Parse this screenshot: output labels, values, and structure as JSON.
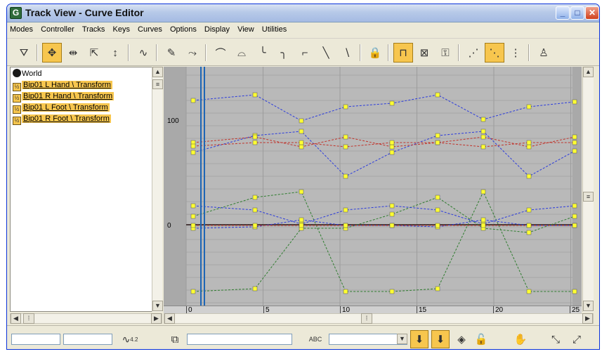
{
  "window": {
    "title": "Track View - Curve Editor"
  },
  "menu": [
    "Modes",
    "Controller",
    "Tracks",
    "Keys",
    "Curves",
    "Options",
    "Display",
    "View",
    "Utilities"
  ],
  "toolbar": {
    "icons": [
      "filters-icon",
      "move-keys-icon",
      "slide-keys-icon",
      "scale-keys-icon",
      "scale-values-icon",
      "add-keys-icon",
      "draw-curves-icon",
      "reduce-keys-icon",
      "tangent-auto-icon",
      "tangent-custom-icon",
      "tangent-fast-icon",
      "tangent-slow-icon",
      "tangent-step-icon",
      "tangent-linear-icon",
      "tangent-smooth-icon",
      "lock-selection-icon",
      "snap-frames-icon",
      "param-curve-oor-icon",
      "show-keyable-icon",
      "show-tangents-icon",
      "lock-tangents-icon",
      "show-all-tangents-icon",
      "biped-icon"
    ]
  },
  "tree": {
    "root": "World",
    "items": [
      {
        "label": "Bip01 L Hand \\ Transform",
        "selected": true
      },
      {
        "label": "Bip01 R Hand \\ Transform",
        "selected": true
      },
      {
        "label": "Bip01 L Foot \\ Transform",
        "selected": true
      },
      {
        "label": "Bip01 R Foot \\ Transform",
        "selected": true
      }
    ]
  },
  "graph": {
    "y_labels": [
      "100",
      "0"
    ],
    "x_ticks": [
      "0",
      "5",
      "10",
      "15",
      "20",
      "25"
    ],
    "current_frame": 1
  },
  "statusbar": {
    "key_stats_label": "4.2",
    "abc_label": "ABC",
    "icons": [
      "zoom-selected-icon",
      "key-filter-icon",
      "snap-keys-icon",
      "lock-keys-icon",
      "pan-icon",
      "zoom-horizontal-icon",
      "zoom-value-icon"
    ]
  },
  "colors": {
    "blue_curve": "#2b3bdc",
    "red_curve": "#c0332b",
    "green_curve": "#2f7d2f",
    "key": "#ffff33",
    "frame_line": "#1e66b5",
    "selected": "#f7c64e"
  }
}
